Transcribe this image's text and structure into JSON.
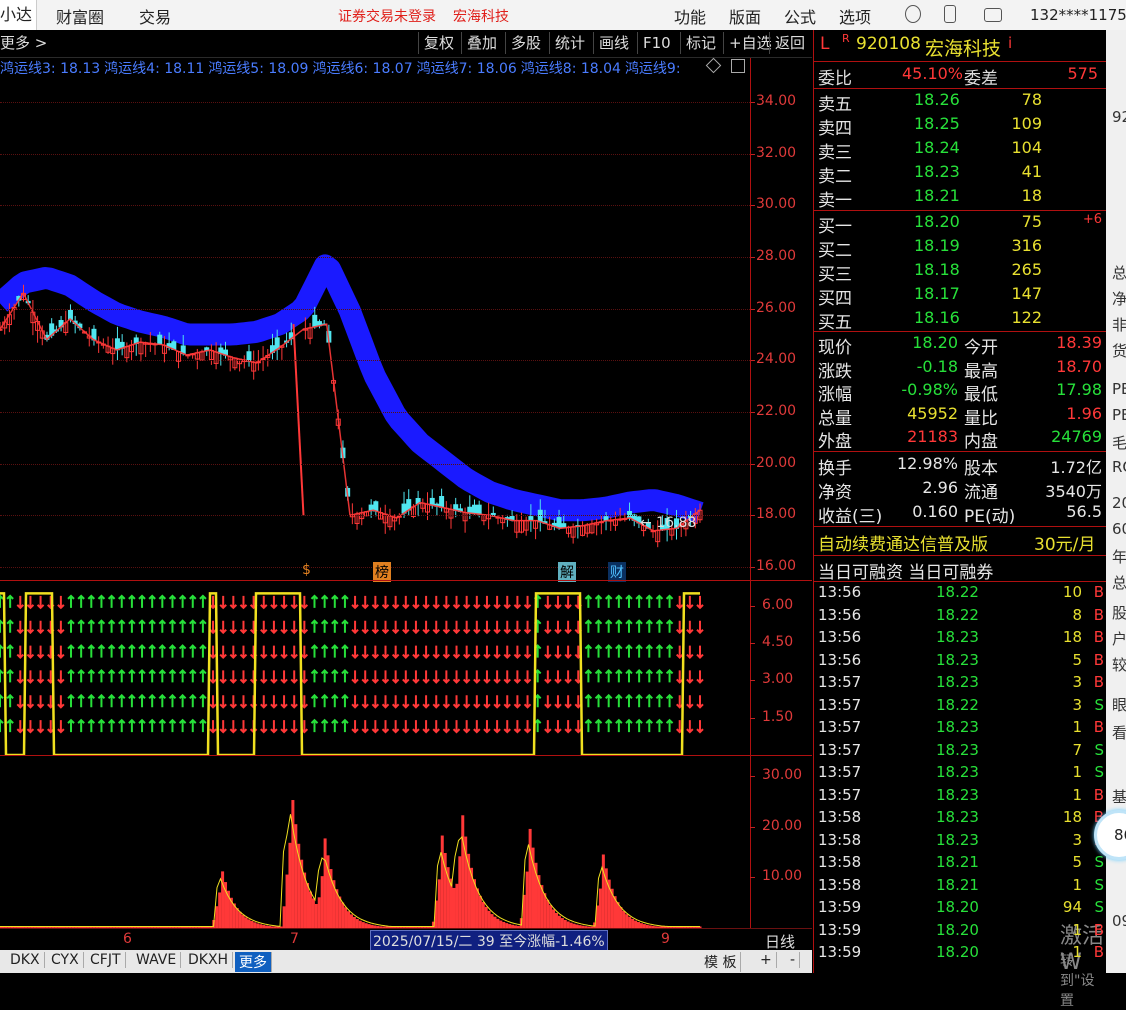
{
  "topbar": {
    "active_tab": "小达",
    "tabs": [
      "财富圈",
      "交易"
    ],
    "login_warning": "证券交易未登录",
    "stock_name": "宏海科技",
    "menus": [
      "功能",
      "版面",
      "公式",
      "选项"
    ],
    "user": "132****1175"
  },
  "toolbar": {
    "more": "更多 >",
    "buttons": [
      "复权",
      "叠加",
      "多股",
      "统计",
      "画线",
      "F10",
      "标记",
      "+自选",
      "返回"
    ]
  },
  "legend": [
    "鸿运线3: 18.13",
    "鸿运线4: 18.11",
    "鸿运线5: 18.09",
    "鸿运线6: 18.07",
    "鸿运线7: 18.06",
    "鸿运线8: 18.04",
    "鸿运线9:"
  ],
  "main_axis": [
    "34.00",
    "32.00",
    "30.00",
    "28.00",
    "26.00",
    "24.00",
    "22.00",
    "20.00",
    "18.00",
    "16.00"
  ],
  "low_label": "← 16.88",
  "event_marks": [
    "$",
    "榜",
    "解",
    "财"
  ],
  "mid_axis": [
    "6.00",
    "4.50",
    "3.00",
    "1.50"
  ],
  "vol_axis": [
    "30.00",
    "20.00",
    "10.00"
  ],
  "date_labels": [
    "6",
    "7",
    "9"
  ],
  "date_info": "2025/07/15/二 39 至今涨幅-1.46%",
  "period": "日线",
  "bottom_tabs": [
    "DKX",
    "CYX",
    "CFJT",
    "WAVE",
    "DKXH",
    "更多"
  ],
  "bottom_right": [
    "模 板",
    "+",
    "-"
  ],
  "quote": {
    "flag_l": "L",
    "flag_r": "R",
    "code": "920108",
    "name": "宏海科技",
    "info": "i",
    "webi_label": "委比",
    "webi": "45.10%",
    "weicha_label": "委差",
    "weicha": "575",
    "asks": [
      {
        "label": "卖五",
        "price": "18.26",
        "vol": "78"
      },
      {
        "label": "卖四",
        "price": "18.25",
        "vol": "109"
      },
      {
        "label": "卖三",
        "price": "18.24",
        "vol": "104"
      },
      {
        "label": "卖二",
        "price": "18.23",
        "vol": "41"
      },
      {
        "label": "卖一",
        "price": "18.21",
        "vol": "18"
      }
    ],
    "bids": [
      {
        "label": "买一",
        "price": "18.20",
        "vol": "75",
        "chg": "+6"
      },
      {
        "label": "买二",
        "price": "18.19",
        "vol": "316",
        "chg": ""
      },
      {
        "label": "买三",
        "price": "18.18",
        "vol": "265",
        "chg": ""
      },
      {
        "label": "买四",
        "price": "18.17",
        "vol": "147",
        "chg": ""
      },
      {
        "label": "买五",
        "price": "18.16",
        "vol": "122",
        "chg": ""
      }
    ],
    "stats": [
      {
        "l1": "现价",
        "v1": "18.20",
        "c1": "gr",
        "l2": "今开",
        "v2": "18.39",
        "c2": "rd"
      },
      {
        "l1": "涨跌",
        "v1": "-0.18",
        "c1": "gr",
        "l2": "最高",
        "v2": "18.70",
        "c2": "rd"
      },
      {
        "l1": "涨幅",
        "v1": "-0.98%",
        "c1": "gr",
        "l2": "最低",
        "v2": "17.98",
        "c2": "gr"
      },
      {
        "l1": "总量",
        "v1": "45952",
        "c1": "yl",
        "l2": "量比",
        "v2": "1.96",
        "c2": "rd"
      },
      {
        "l1": "外盘",
        "v1": "21183",
        "c1": "rd",
        "l2": "内盘",
        "v2": "24769",
        "c2": "gr"
      }
    ],
    "stats2": [
      {
        "l1": "换手",
        "v1": "12.98%",
        "l2": "股本",
        "v2": "1.72亿"
      },
      {
        "l1": "净资",
        "v1": "2.96",
        "l2": "流通",
        "v2": "3540万"
      },
      {
        "l1": "收益(三)",
        "v1": "0.160",
        "l2": "PE(动)",
        "v2": "56.5"
      }
    ],
    "promo": "自动续费通达信普及版",
    "promo_price": "30元/月",
    "margin": "当日可融资 当日可融券",
    "ticks": [
      {
        "t": "13:56",
        "p": "18.22",
        "v": "10",
        "s": "B"
      },
      {
        "t": "13:56",
        "p": "18.22",
        "v": "8",
        "s": "B"
      },
      {
        "t": "13:56",
        "p": "18.23",
        "v": "18",
        "s": "B"
      },
      {
        "t": "13:56",
        "p": "18.23",
        "v": "5",
        "s": "B"
      },
      {
        "t": "13:57",
        "p": "18.23",
        "v": "3",
        "s": "B"
      },
      {
        "t": "13:57",
        "p": "18.22",
        "v": "3",
        "s": "S"
      },
      {
        "t": "13:57",
        "p": "18.23",
        "v": "1",
        "s": "B"
      },
      {
        "t": "13:57",
        "p": "18.23",
        "v": "7",
        "s": "S"
      },
      {
        "t": "13:57",
        "p": "18.23",
        "v": "1",
        "s": "S"
      },
      {
        "t": "13:57",
        "p": "18.23",
        "v": "1",
        "s": "B"
      },
      {
        "t": "13:58",
        "p": "18.23",
        "v": "18",
        "s": "B"
      },
      {
        "t": "13:58",
        "p": "18.23",
        "v": "3",
        "s": "B"
      },
      {
        "t": "13:58",
        "p": "18.21",
        "v": "5",
        "s": "S"
      },
      {
        "t": "13:58",
        "p": "18.21",
        "v": "1",
        "s": "S"
      },
      {
        "t": "13:59",
        "p": "18.20",
        "v": "94",
        "s": "S"
      },
      {
        "t": "13:59",
        "p": "18.20",
        "v": "1",
        "s": "B"
      },
      {
        "t": "13:59",
        "p": "18.20",
        "v": "1",
        "s": "B"
      }
    ],
    "watermark": "激活 W",
    "watermark2": "转到\"设置"
  },
  "strip": [
    "92",
    "总",
    "净",
    "非",
    "货",
    "PE",
    "PE",
    "毛",
    "RO",
    "20",
    "60",
    "年",
    "总",
    "股",
    "户",
    "较",
    "眼",
    "看",
    "基",
    "09"
  ],
  "badge": "86",
  "colors": {
    "up": "#ff3838",
    "down": "#27e03a",
    "band": "#1a1aff",
    "cyan": "#50e6f0",
    "yellow": "#f0e020"
  },
  "chart_data": {
    "type": "candlestick",
    "ylim": [
      15.5,
      35.0
    ],
    "price_ticks": [
      34,
      32,
      30,
      28,
      26,
      24,
      22,
      20,
      18,
      16
    ],
    "band_center": [
      26.2,
      27.0,
      27.2,
      26.9,
      26.3,
      25.8,
      25.5,
      25.3,
      25.0,
      25.0,
      25.0,
      25.1,
      25.4,
      26.0,
      27.8,
      25.9,
      23.5,
      21.8,
      20.8,
      20.1,
      19.4,
      18.9,
      18.6,
      18.4,
      18.2,
      18.2,
      18.3,
      18.5,
      18.6,
      18.4,
      18.1
    ],
    "price_line": [
      25.2,
      26.6,
      24.8,
      25.6,
      24.8,
      24.4,
      24.7,
      24.6,
      24.2,
      24.4,
      24.1,
      23.9,
      24.5,
      25.2,
      25.4,
      18.0,
      18.2,
      17.9,
      18.5,
      18.3,
      18.1,
      18.0,
      17.8,
      17.8,
      17.5,
      17.6,
      17.8,
      17.9,
      17.4,
      17.5,
      18.2
    ],
    "vol_ylim": [
      0,
      34
    ],
    "vol_ticks": [
      30,
      20,
      10
    ],
    "vol_peaks": [
      {
        "x": 0.315,
        "h": 13
      },
      {
        "x": 0.415,
        "h": 30
      },
      {
        "x": 0.462,
        "h": 20
      },
      {
        "x": 0.63,
        "h": 20
      },
      {
        "x": 0.658,
        "h": 26
      },
      {
        "x": 0.755,
        "h": 22
      },
      {
        "x": 0.86,
        "h": 16
      }
    ],
    "mid_ylim": [
      0,
      7
    ],
    "mid_ticks": [
      6,
      4.5,
      3,
      1.5
    ]
  }
}
